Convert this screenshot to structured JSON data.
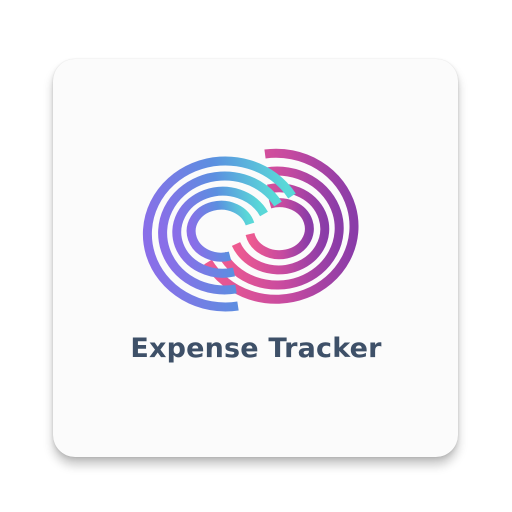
{
  "app": {
    "name": "Expense Tracker"
  },
  "logo": {
    "icon": "interlocking-rings-logo-icon",
    "gradient_left": [
      "#8a6ee8",
      "#5b8fe0",
      "#59d8d8"
    ],
    "gradient_right": [
      "#ee5a90",
      "#c64aa0",
      "#8a3ca8"
    ]
  },
  "colors": {
    "title": "#3e5068",
    "card_background": "#fbfbfb"
  }
}
